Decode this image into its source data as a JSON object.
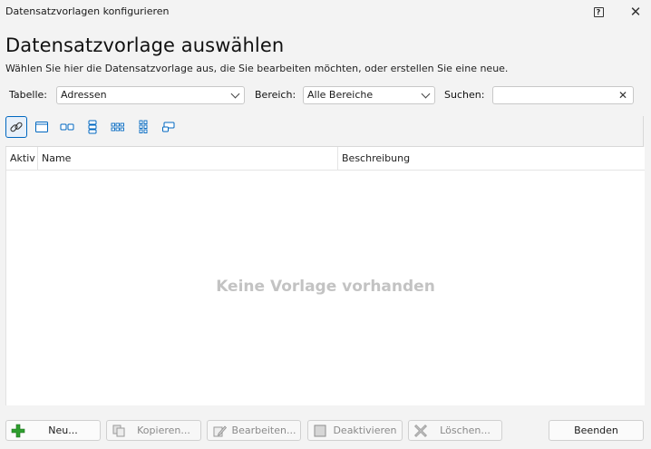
{
  "window": {
    "title": "Datensatzvorlagen konfigurieren",
    "help_label": "?"
  },
  "header": {
    "title": "Datensatzvorlage auswählen",
    "subtitle": "Wählen Sie hier die Datensatzvorlage aus, die Sie bearbeiten möchten, oder erstellen Sie eine neue."
  },
  "filters": {
    "table_label": "Tabelle:",
    "table_value": "Adressen",
    "area_label": "Bereich:",
    "area_value": "Alle Bereiche",
    "search_label": "Suchen:",
    "search_value": "",
    "search_placeholder": ""
  },
  "toolbar": {
    "icons": [
      "link-icon",
      "single-pane-icon",
      "side-by-side-icon",
      "stacked-icon",
      "grid-rows-icon",
      "grid-columns-icon",
      "window-layout-icon"
    ],
    "active_index": 0
  },
  "grid": {
    "columns": [
      "Aktiv",
      "Name",
      "Beschreibung"
    ],
    "empty_text": "Keine Vorlage vorhanden"
  },
  "buttons": {
    "new": "Neu...",
    "copy": "Kopieren...",
    "edit": "Bearbeiten...",
    "deactivate": "Deaktivieren",
    "delete": "Löschen...",
    "close": "Beenden"
  },
  "colors": {
    "accent": "#0067c0",
    "add_green": "#2e9e2e",
    "empty_text": "#c3c3c3"
  }
}
